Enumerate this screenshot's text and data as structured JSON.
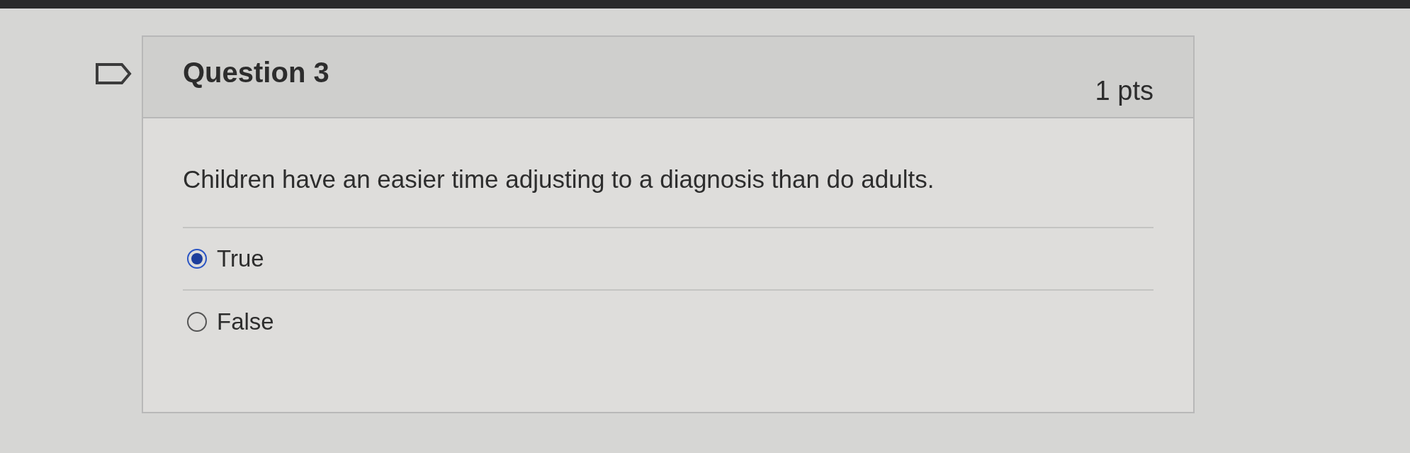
{
  "question": {
    "title": "Question 3",
    "points": "1 pts",
    "prompt": "Children have an easier time adjusting to a diagnosis than do adults.",
    "options": [
      {
        "label": "True",
        "selected": true
      },
      {
        "label": "False",
        "selected": false
      }
    ]
  }
}
